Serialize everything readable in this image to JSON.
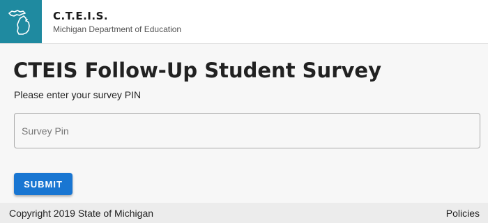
{
  "header": {
    "logo_icon": "michigan-state-icon",
    "logo_color": "#1f8aa0",
    "title": "C.T.E.I.S.",
    "subtitle": "Michigan Department of Education"
  },
  "main": {
    "title": "CTEIS Follow-Up Student Survey",
    "prompt": "Please enter your survey PIN",
    "pin_input": {
      "value": "",
      "placeholder": "Survey Pin"
    },
    "submit_label": "SUBMIT",
    "accent_color": "#1976d2"
  },
  "footer": {
    "copyright": "Copyright 2019 State of Michigan",
    "policies_label": "Policies"
  }
}
